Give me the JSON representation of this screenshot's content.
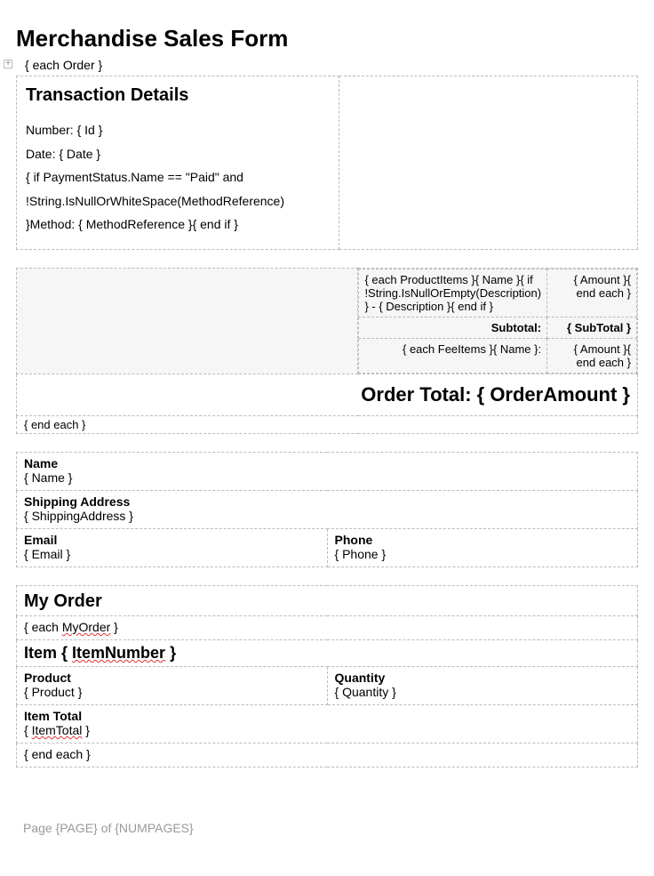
{
  "title": "Merchandise Sales Form",
  "each_order": "{ each Order }",
  "transaction": {
    "heading": "Transaction Details",
    "number": "Number: { Id }",
    "date": "Date: { Date }",
    "cond1": "{ if PaymentStatus.Name == \"Paid\" and",
    "cond2": "!String.IsNullOrWhiteSpace(MethodReference)",
    "cond3": "}Method: { MethodReference }{ end if }"
  },
  "items": {
    "product_line": "{ each ProductItems }{ Name }{ if !String.IsNullOrEmpty(Description) } - { Description }{ end if }",
    "product_amount": "{ Amount }{ end each }",
    "subtotal_label": "Subtotal:",
    "subtotal_value": "{ SubTotal }",
    "fee_line": "{ each FeeItems }{ Name }:",
    "fee_amount": "{ Amount }{ end each }"
  },
  "order_total": "Order Total: { OrderAmount }",
  "end_each": "{ end each }",
  "contact": {
    "name_label": "Name",
    "name_value": "{ Name }",
    "ship_label": "Shipping Address",
    "ship_value": "{ ShippingAddress }",
    "email_label": "Email",
    "email_value": "{ Email }",
    "phone_label": "Phone",
    "phone_value": "{ Phone }"
  },
  "myorder": {
    "heading": "My Order",
    "each_label_pre": "{ each ",
    "each_label_under": "MyOrder",
    "each_label_post": " }",
    "item_label_pre": "Item { ",
    "item_label_under": "ItemNumber",
    "item_label_post": " }",
    "product_label": "Product",
    "product_value": "{ Product }",
    "quantity_label": "Quantity",
    "quantity_value": "{ Quantity }",
    "total_label": "Item Total",
    "total_pre": "{ ",
    "total_under": "ItemTotal",
    "total_post": " }",
    "end_each": "{ end each }"
  },
  "footer": "Page {PAGE} of {NUMPAGES}"
}
